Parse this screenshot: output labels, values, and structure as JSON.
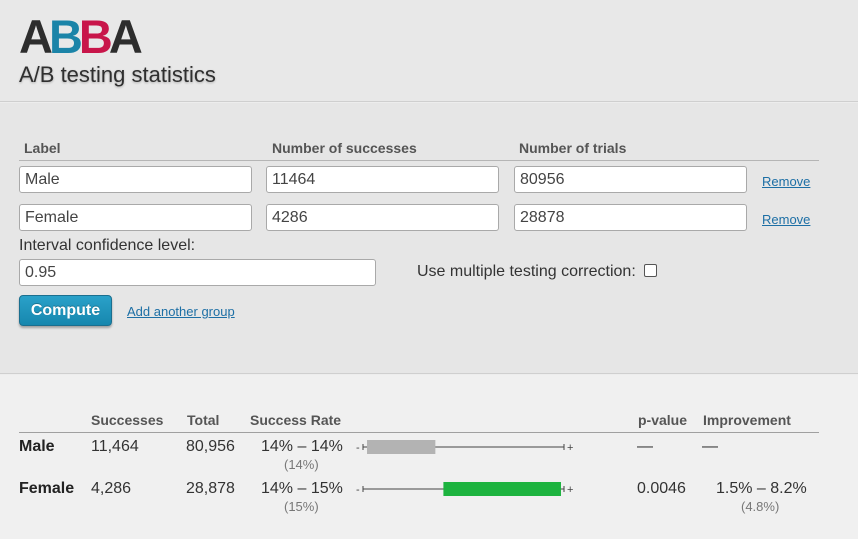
{
  "brand": {
    "letters": [
      {
        "char": "A",
        "color": "#2d2d2d"
      },
      {
        "char": "B",
        "color": "#1b84a8"
      },
      {
        "char": "B",
        "color": "#c8164a"
      },
      {
        "char": "A",
        "color": "#2d2d2d"
      }
    ],
    "subtitle": "A/B testing statistics"
  },
  "form": {
    "headers": {
      "label": "Label",
      "successes": "Number of successes",
      "trials": "Number of trials"
    },
    "groups": [
      {
        "label": "Male",
        "successes": "11464",
        "trials": "80956",
        "remove": "Remove"
      },
      {
        "label": "Female",
        "successes": "4286",
        "trials": "28878",
        "remove": "Remove"
      }
    ],
    "confidence_label": "Interval confidence level:",
    "confidence_value": "0.95",
    "multiple_testing_label": "Use multiple testing correction:",
    "multiple_testing_checked": false,
    "compute_label": "Compute",
    "add_group_label": "Add another group"
  },
  "results": {
    "headers": {
      "successes": "Successes",
      "total": "Total",
      "success_rate": "Success Rate",
      "p_value": "p-value",
      "improvement": "Improvement"
    },
    "rows": [
      {
        "label": "Male",
        "successes": "11,464",
        "total": "80,956",
        "rate_range": "14% – 14%",
        "rate_point": "(14%)",
        "p_value": "—",
        "improvement_range": "—",
        "improvement_point": "",
        "bar_start": 0.02,
        "bar_end": 0.36,
        "bar_color": "#b3b3b3"
      },
      {
        "label": "Female",
        "successes": "4,286",
        "total": "28,878",
        "rate_range": "14% – 15%",
        "rate_point": "(15%)",
        "p_value": "0.0046",
        "improvement_range": "1.5% – 8.2%",
        "improvement_point": "(4.8%)",
        "bar_start": 0.4,
        "bar_end": 0.985,
        "bar_color": "#1db33f"
      }
    ],
    "minus_glyph": "-",
    "plus_glyph": "+"
  }
}
